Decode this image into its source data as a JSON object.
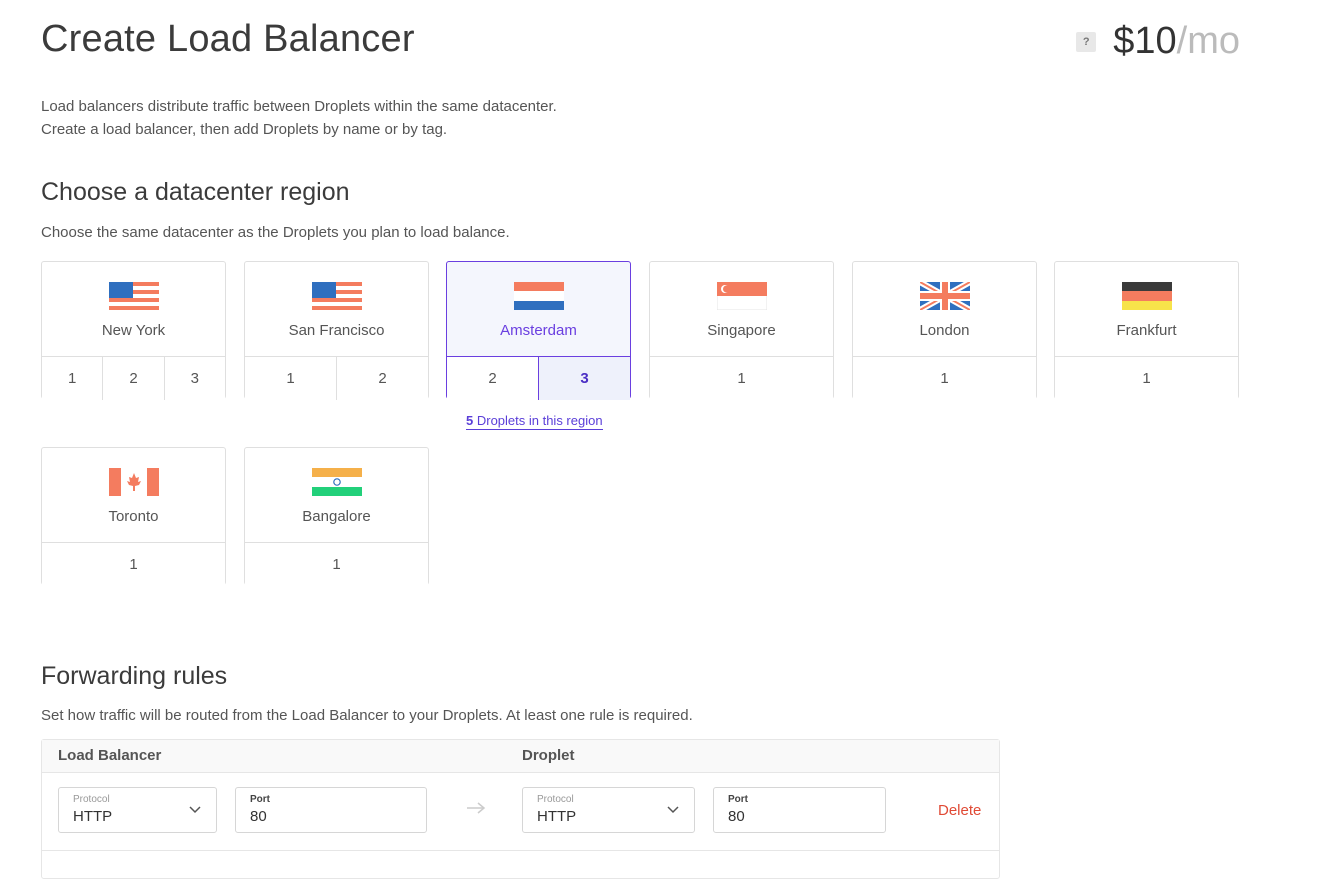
{
  "header": {
    "title": "Create Load Balancer",
    "help": "?",
    "price_amount": "$10",
    "price_period": "/mo"
  },
  "intro": {
    "line1": "Load balancers distribute traffic between Droplets within the same datacenter.",
    "line2": "Create a load balancer, then add Droplets by name or by tag."
  },
  "region_section": {
    "title": "Choose a datacenter region",
    "subtitle": "Choose the same datacenter as the Droplets you plan to load balance.",
    "regions": [
      {
        "name": "New York",
        "flag": "us-flag-icon",
        "datacenters": [
          "1",
          "2",
          "3"
        ]
      },
      {
        "name": "San Francisco",
        "flag": "us-flag-icon",
        "datacenters": [
          "1",
          "2"
        ]
      },
      {
        "name": "Amsterdam",
        "flag": "nl-flag-icon",
        "datacenters": [
          "2",
          "3"
        ]
      },
      {
        "name": "Singapore",
        "flag": "sg-flag-icon",
        "datacenters": [
          "1"
        ]
      },
      {
        "name": "London",
        "flag": "uk-flag-icon",
        "datacenters": [
          "1"
        ]
      },
      {
        "name": "Frankfurt",
        "flag": "de-flag-icon",
        "datacenters": [
          "1"
        ]
      },
      {
        "name": "Toronto",
        "flag": "ca-flag-icon",
        "datacenters": [
          "1"
        ]
      },
      {
        "name": "Bangalore",
        "flag": "in-flag-icon",
        "datacenters": [
          "1"
        ]
      }
    ],
    "selected_region": "Amsterdam",
    "selected_datacenter": "3",
    "droplets_count": "5",
    "droplets_text": " Droplets in this region"
  },
  "forwarding": {
    "title": "Forwarding rules",
    "subtitle": "Set how traffic will be routed from the Load Balancer to your Droplets. At least one rule is required.",
    "col_lb": "Load Balancer",
    "col_droplet": "Droplet",
    "rule": {
      "protocol_label": "Protocol",
      "lb_protocol": "HTTP",
      "port_label": "Port",
      "lb_port": "80",
      "droplet_protocol": "HTTP",
      "droplet_port": "80",
      "delete_label": "Delete"
    }
  },
  "colors": {
    "accent": "#6a3fe0",
    "delete": "#e04a35"
  }
}
